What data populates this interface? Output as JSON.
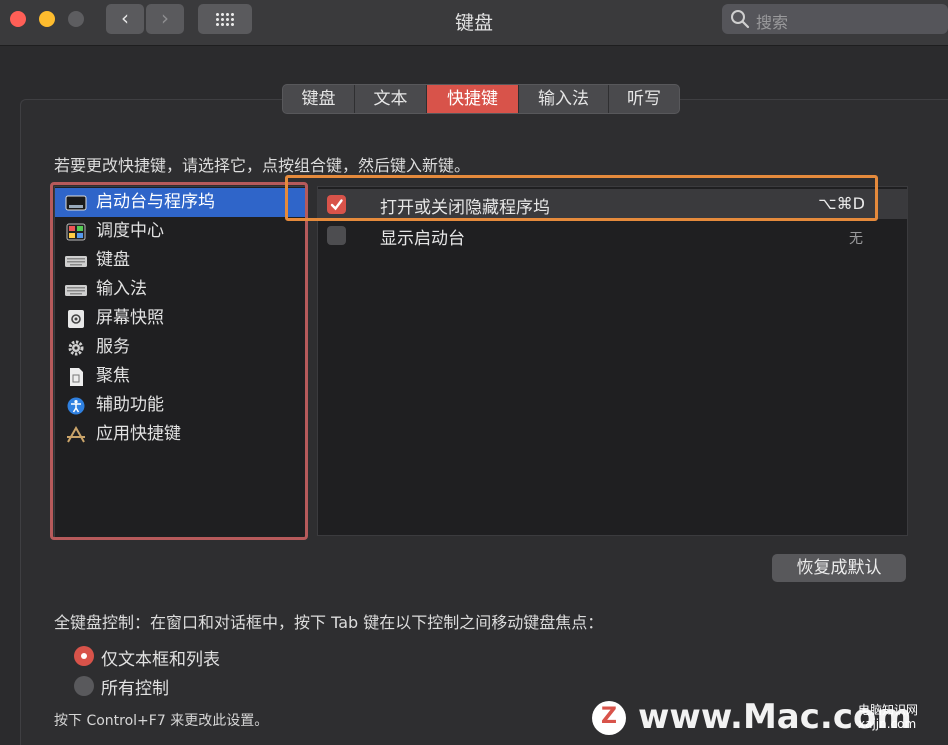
{
  "window": {
    "title": "键盘"
  },
  "search": {
    "placeholder": "搜索"
  },
  "tabs": [
    {
      "label": "键盘",
      "active": false
    },
    {
      "label": "文本",
      "active": false
    },
    {
      "label": "快捷键",
      "active": true
    },
    {
      "label": "输入法",
      "active": false
    },
    {
      "label": "听写",
      "active": false
    }
  ],
  "instruction": "若要更改快捷键，请选择它，点按组合键，然后键入新键。",
  "categories": [
    {
      "label": "启动台与程序坞",
      "icon": "dock-icon",
      "selected": true
    },
    {
      "label": "调度中心",
      "icon": "mission-control-icon",
      "selected": false
    },
    {
      "label": "键盘",
      "icon": "keyboard-icon",
      "selected": false
    },
    {
      "label": "输入法",
      "icon": "keyboard-icon",
      "selected": false
    },
    {
      "label": "屏幕快照",
      "icon": "screenshot-icon",
      "selected": false
    },
    {
      "label": "服务",
      "icon": "gear-icon",
      "selected": false
    },
    {
      "label": "聚焦",
      "icon": "document-icon",
      "selected": false
    },
    {
      "label": "辅助功能",
      "icon": "accessibility-icon",
      "selected": false
    },
    {
      "label": "应用快捷键",
      "icon": "app-store-icon",
      "selected": false
    }
  ],
  "shortcuts": [
    {
      "label": "打开或关闭隐藏程序坞",
      "key": "⌥⌘D",
      "checked": true
    },
    {
      "label": "显示启动台",
      "key": "无",
      "checked": false
    }
  ],
  "reset_button": "恢复成默认",
  "keyboard_control": {
    "title": "全键盘控制：在窗口和对话框中，按下 Tab 键在以下控制之间移动键盘焦点：",
    "options": [
      {
        "label": "仅文本框和列表",
        "selected": true
      },
      {
        "label": "所有控制",
        "selected": false
      }
    ],
    "note": "按下 Control+F7 来更改此设置。"
  },
  "watermark": {
    "text": "www.Mac.com",
    "logo_letter": "Z",
    "small_line1": "电脑知识网",
    "small_line2": "xajjn.com"
  },
  "colors": {
    "accent_red": "#d8534a",
    "selection_blue": "#2f65c9",
    "highlight_orange": "#e58a3c",
    "highlight_pink": "#b65a5b"
  }
}
